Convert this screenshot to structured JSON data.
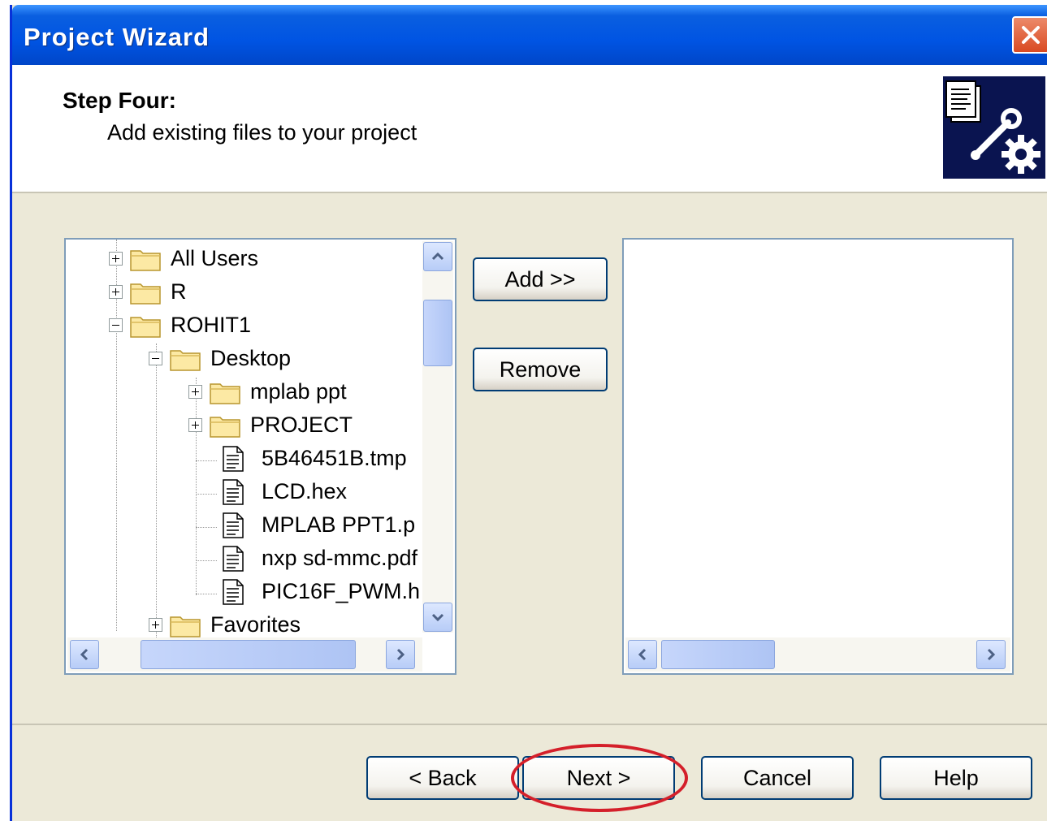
{
  "window": {
    "title": "Project Wizard"
  },
  "header": {
    "step_title": "Step Four:",
    "step_desc": "Add existing files to your project"
  },
  "tree": {
    "items": [
      {
        "label": "All Users",
        "type": "folder",
        "expander": "plus",
        "level": 1
      },
      {
        "label": "R",
        "type": "folder",
        "expander": "plus",
        "level": 1
      },
      {
        "label": "ROHIT1",
        "type": "folder",
        "expander": "minus",
        "level": 1
      },
      {
        "label": "Desktop",
        "type": "folder",
        "expander": "minus",
        "level": 2
      },
      {
        "label": "mplab ppt",
        "type": "folder",
        "expander": "plus",
        "level": 3
      },
      {
        "label": "PROJECT",
        "type": "folder",
        "expander": "plus",
        "level": 3
      },
      {
        "label": "5B46451B.tmp",
        "type": "file",
        "level": 3
      },
      {
        "label": "LCD.hex",
        "type": "file",
        "level": 3
      },
      {
        "label": "MPLAB PPT1.p",
        "type": "file",
        "level": 3
      },
      {
        "label": "nxp sd-mmc.pdf",
        "type": "file",
        "level": 3
      },
      {
        "label": "PIC16F_PWM.h",
        "type": "file",
        "level": 3
      },
      {
        "label": "Favorites",
        "type": "folder",
        "expander": "plus",
        "level": 2
      }
    ]
  },
  "buttons": {
    "add": "Add >>",
    "remove": "Remove",
    "back": "< Back",
    "next": "Next >",
    "cancel": "Cancel",
    "help": "Help"
  },
  "colors": {
    "titlebar": "#0054e3",
    "highlight_ring": "#d41f2a",
    "dialog_bg": "#ece9d8"
  }
}
